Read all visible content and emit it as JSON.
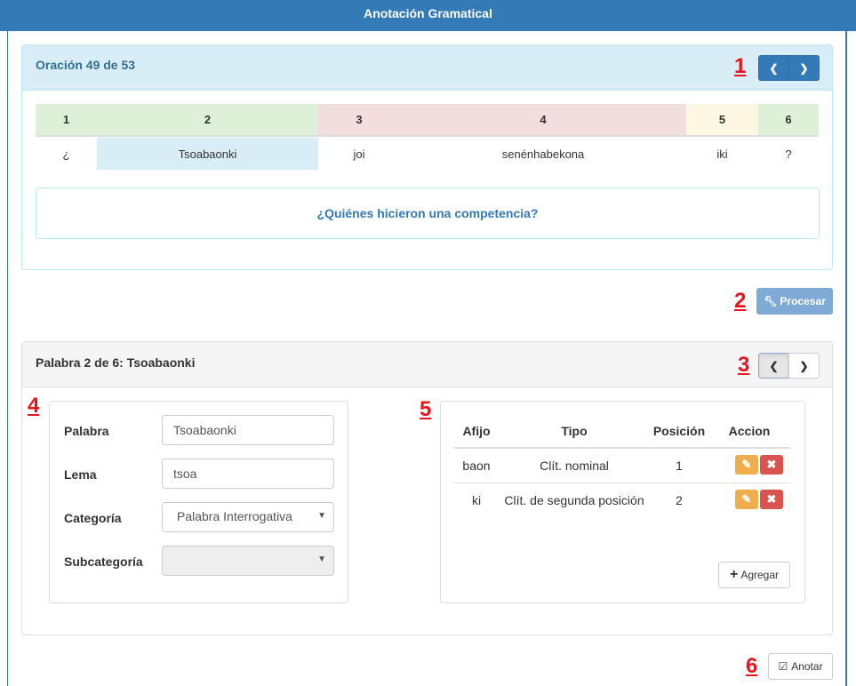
{
  "app": {
    "title": "Anotación Gramatical"
  },
  "sentence": {
    "header": "Oración 49 de 53",
    "marker": "1",
    "prev_icon": "chevron-left-icon",
    "next_icon": "chevron-right-icon",
    "tokens": [
      {
        "index": "1",
        "word": "¿",
        "color": "#dff0d8"
      },
      {
        "index": "2",
        "word": "Tsoabaonki",
        "color": "#dff0d8",
        "selected": true
      },
      {
        "index": "3",
        "word": "joi",
        "color": "#f2dede"
      },
      {
        "index": "4",
        "word": "senénhabekona",
        "color": "#f2dede"
      },
      {
        "index": "5",
        "word": "iki",
        "color": "#fcf8e3"
      },
      {
        "index": "6",
        "word": "?",
        "color": "#dff0d8"
      }
    ],
    "translation": "¿Quiénes hicieron una competencia?"
  },
  "process": {
    "marker": "2",
    "label": "Procesar",
    "icon": "wrench-icon"
  },
  "word": {
    "header": "Palabra 2 de 6: Tsoabaonki",
    "marker": "3",
    "form_marker": "4",
    "fields": {
      "palabra_label": "Palabra",
      "palabra_value": "Tsoabaonki",
      "lema_label": "Lema",
      "lema_value": "tsoa",
      "categoria_label": "Categoría",
      "categoria_value": "Palabra Interrogativa",
      "subcategoria_label": "Subcategoría",
      "subcategoria_value": ""
    }
  },
  "affixes": {
    "marker": "5",
    "columns": [
      "Afijo",
      "Tipo",
      "Posición",
      "Accion"
    ],
    "rows": [
      {
        "afijo": "baon",
        "tipo": "Clít. nominal",
        "posicion": "1"
      },
      {
        "afijo": "ki",
        "tipo": "Clít. de segunda posición",
        "posicion": "2"
      }
    ],
    "add_label": "Agregar"
  },
  "annotate": {
    "marker": "6",
    "label": "Anotar",
    "icon": "check-square-icon"
  }
}
